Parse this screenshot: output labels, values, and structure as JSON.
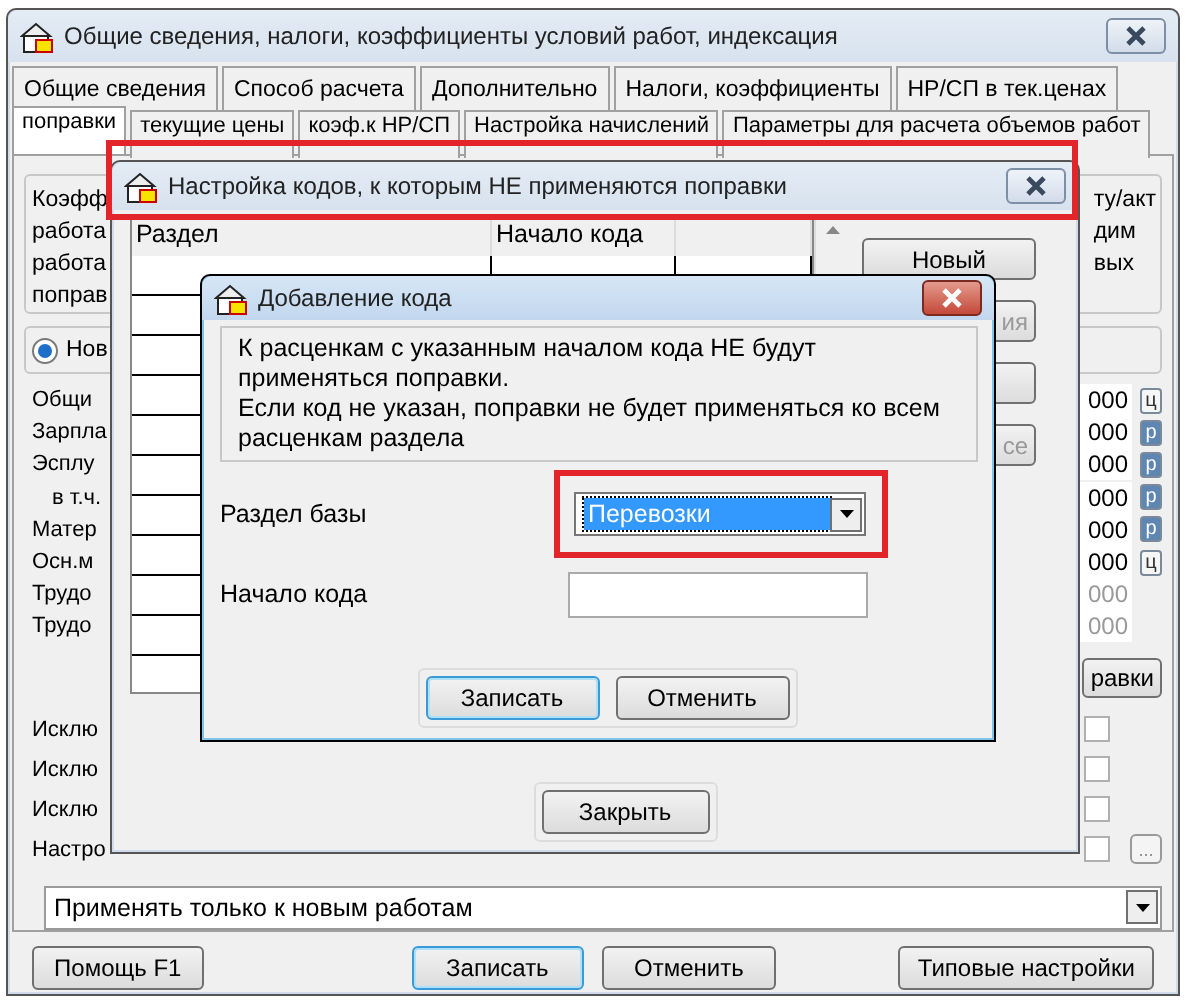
{
  "main_window": {
    "title": "Общие сведения, налоги, коэффициенты условий работ, индексация",
    "tabs_row_1": [
      {
        "label": "Общие сведения",
        "selected": false
      },
      {
        "label": "Способ расчета",
        "selected": false
      },
      {
        "label": "Дополнительно",
        "selected": false
      },
      {
        "label": "Налоги, коэффициенты",
        "selected": false
      },
      {
        "label": "НР/СП в тек.ценах",
        "selected": false
      }
    ],
    "tabs_row_2": [
      {
        "label": "поправки",
        "selected": true
      },
      {
        "label": "текущие цены",
        "selected": false
      },
      {
        "label": "коэф.к НР/СП",
        "selected": false
      },
      {
        "label": "Настройка начислений",
        "selected": false
      },
      {
        "label": "Параметры для расчета объемов работ",
        "selected": false
      }
    ],
    "group_lines_left": [
      "Коэфф",
      "работа",
      "работа",
      "поправ"
    ],
    "group_lines_right": [
      "ту/акт",
      "дим",
      "вых"
    ],
    "radio": {
      "label": "Нов",
      "selected": true
    },
    "rows": [
      {
        "label": "Общи",
        "value": "000",
        "unit": "ц",
        "disabled": false
      },
      {
        "label": "Зарпла",
        "value": "000",
        "unit": "р",
        "disabled": false
      },
      {
        "label": "Эсплу",
        "value": "000",
        "unit": "р",
        "disabled": false
      },
      {
        "label": "в т.ч.",
        "value": "000",
        "unit": "р",
        "disabled": false
      },
      {
        "label": "Матер",
        "value": "000",
        "unit": "р",
        "disabled": false
      },
      {
        "label": "Осн.м",
        "value": "000",
        "unit": "ц",
        "disabled": false
      },
      {
        "label": "Трудо",
        "value": "000",
        "disabled": true
      },
      {
        "label": "Трудо",
        "value": "000",
        "disabled": true
      }
    ],
    "side_button": "равки",
    "option_rows": [
      {
        "label": "Исклю",
        "checked": false
      },
      {
        "label": "Исклю",
        "checked": false
      },
      {
        "label": "Исклю",
        "checked": false
      },
      {
        "label": "Настро",
        "checked": false,
        "has_browse": true
      }
    ],
    "browse_button": "...",
    "apply_mode": "Применять только к новым работам",
    "buttons": [
      {
        "label": "Помощь F1",
        "focused": false
      },
      {
        "label": "Записать",
        "focused": true
      },
      {
        "label": "Отменить",
        "focused": false
      },
      {
        "label": "Типовые настройки",
        "focused": false
      }
    ]
  },
  "codes_dialog": {
    "title": "Настройка кодов, к которым НЕ применяются поправки",
    "columns": [
      "Раздел",
      "Начало кода"
    ],
    "side_buttons": [
      {
        "kind": "label",
        "label": "Новый"
      },
      {
        "kind": "label",
        "label": "ия"
      },
      {
        "kind": "blank"
      },
      {
        "kind": "label",
        "label": "се"
      }
    ],
    "close_button": "Закрыть"
  },
  "add_code_dialog": {
    "title": "Добавление кода",
    "message_lines": [
      "К расценкам с указанным началом кода НЕ будут",
      "применяться поправки.",
      "Если код не указан, поправки не будет применяться ко всем",
      "расценкам раздела"
    ],
    "section_label": "Раздел базы",
    "section_value": "Перевозки",
    "code_label": "Начало кода",
    "buttons": [
      {
        "label": "Записать",
        "focused": true
      },
      {
        "label": "Отменить",
        "focused": false
      }
    ]
  }
}
